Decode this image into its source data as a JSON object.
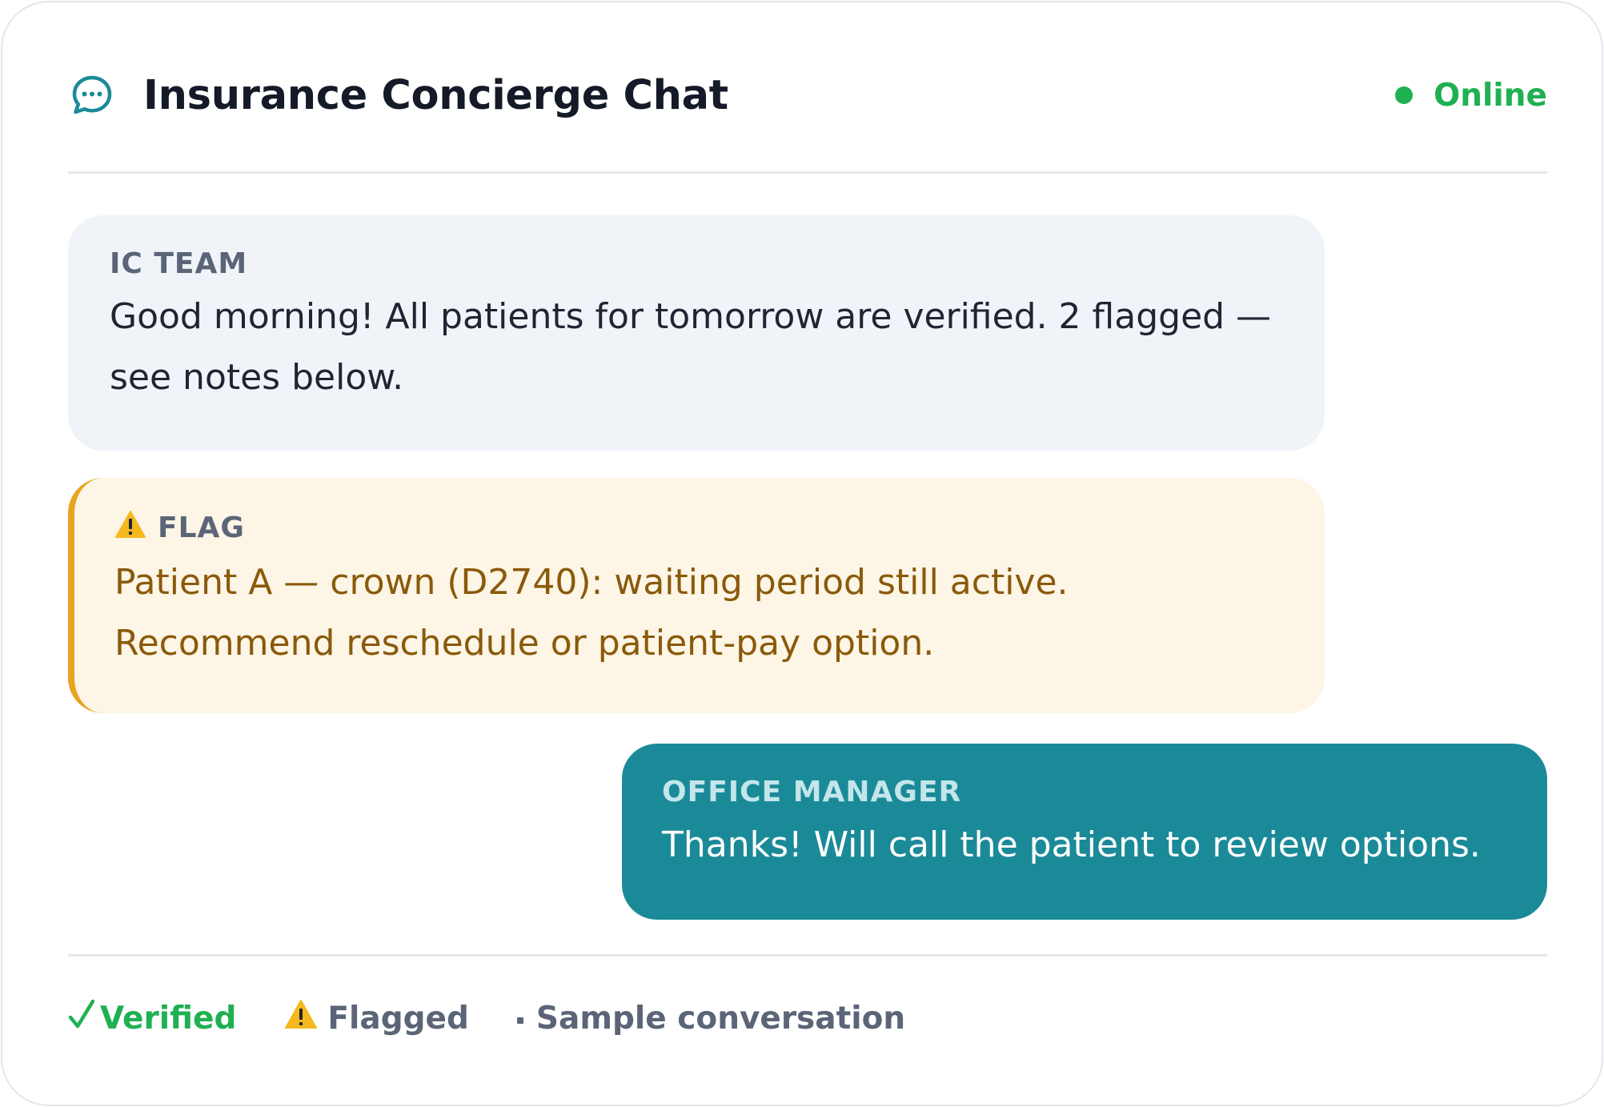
{
  "header": {
    "title": "Insurance Concierge Chat",
    "icon": "chat-bubble-icon",
    "status": "Online",
    "status_color": "#1fb052"
  },
  "messages": [
    {
      "sender": "IC TEAM",
      "text": "Good morning! All patients for tomorrow are verified. 2 flagged — see notes below.",
      "background": "#f0f3f8"
    },
    {
      "sender": "FLAG",
      "icon": "warning-icon",
      "text": "Patient A — crown (D2740): waiting period still active. Recommend reschedule or patient-pay option.",
      "background": "#fdf5e6",
      "accent": "#e8a420"
    },
    {
      "sender": "OFFICE MANAGER",
      "text": "Thanks! Will call the patient to review options.",
      "background": "#1b8a98"
    }
  ],
  "legend": {
    "verified": "Verified",
    "flagged": "Flagged",
    "sample": "Sample conversation"
  }
}
